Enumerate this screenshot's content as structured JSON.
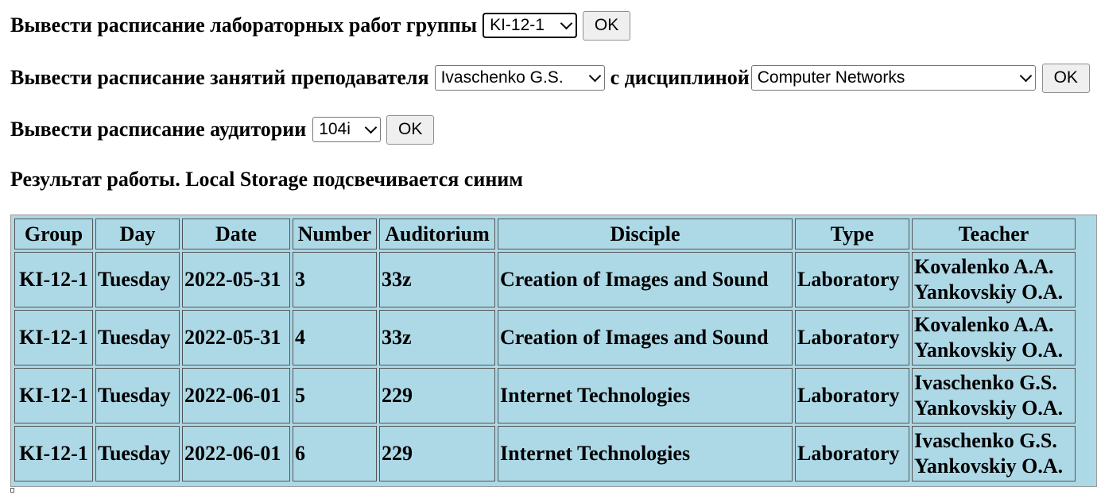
{
  "form_group": {
    "label": "Вывести расписание лабораторных работ группы",
    "group_value": "KI-12-1",
    "ok_label": "OK"
  },
  "form_teacher": {
    "label": "Вывести расписание занятий преподавателя",
    "teacher_value": "Ivaschenko G.S.",
    "discipline_label": "с дисциплиной",
    "discipline_value": "Computer Networks",
    "ok_label": "OK"
  },
  "form_auditorium": {
    "label": "Вывести расписание аудитории",
    "auditorium_value": "104i",
    "ok_label": "OK"
  },
  "result_heading": "Результат работы. Local Storage подсвечивается синим",
  "result_highlight_color": "#add8e6",
  "table": {
    "headers": [
      "Group",
      "Day",
      "Date",
      "Number",
      "Auditorium",
      "Disciple",
      "Type",
      "Teacher"
    ],
    "rows": [
      {
        "group": "KI-12-1",
        "day": "Tuesday",
        "date": "2022-05-31",
        "number": "3",
        "auditorium": "33z",
        "disciple": "Creation of Images and Sound",
        "type": "Laboratory",
        "teacher1": "Kovalenko A.A.",
        "teacher2": "Yankovskiy O.A."
      },
      {
        "group": "KI-12-1",
        "day": "Tuesday",
        "date": "2022-05-31",
        "number": "4",
        "auditorium": "33z",
        "disciple": "Creation of Images and Sound",
        "type": "Laboratory",
        "teacher1": "Kovalenko A.A.",
        "teacher2": "Yankovskiy O.A."
      },
      {
        "group": "KI-12-1",
        "day": "Tuesday",
        "date": "2022-06-01",
        "number": "5",
        "auditorium": "229",
        "disciple": "Internet Technologies",
        "type": "Laboratory",
        "teacher1": "Ivaschenko G.S.",
        "teacher2": "Yankovskiy O.A."
      },
      {
        "group": "KI-12-1",
        "day": "Tuesday",
        "date": "2022-06-01",
        "number": "6",
        "auditorium": "229",
        "disciple": "Internet Technologies",
        "type": "Laboratory",
        "teacher1": "Ivaschenko G.S.",
        "teacher2": "Yankovskiy O.A."
      }
    ]
  }
}
